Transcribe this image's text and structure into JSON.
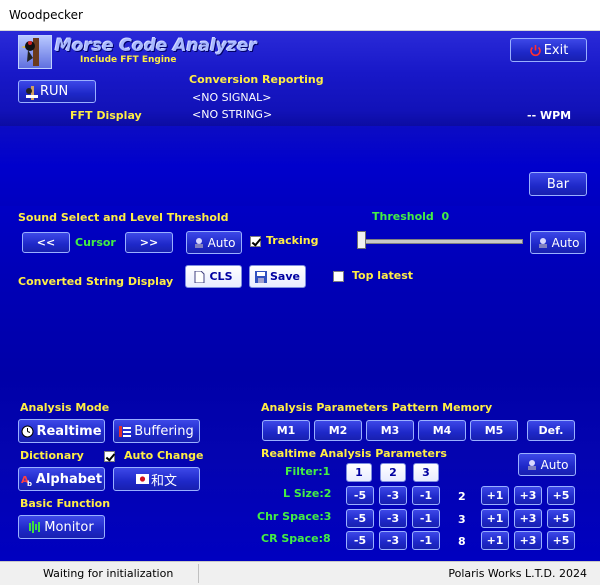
{
  "window": {
    "title": "Woodpecker"
  },
  "header": {
    "app_name": "Morse Code Analyzer",
    "subtitle": "Include FFT Engine",
    "exit_label": "Exit"
  },
  "run": {
    "label": "RUN"
  },
  "conversion": {
    "title": "Conversion Reporting",
    "signal": "<NO SIGNAL>",
    "string": "<NO STRING>",
    "wpm": "-- WPM"
  },
  "fft": {
    "label": "FFT Display",
    "bar_label": "Bar"
  },
  "sound": {
    "title": "Sound Select and Level Threshold",
    "prev": "<<",
    "cursor_label": "Cursor",
    "next": ">>",
    "auto_label": "Auto",
    "tracking_label": "Tracking",
    "tracking_checked": true,
    "threshold_label": "Threshold",
    "threshold_value": "0",
    "threshold_auto_label": "Auto",
    "threshold_level": 0
  },
  "converted": {
    "title": "Converted String Display",
    "cls_label": "CLS",
    "save_label": "Save",
    "top_latest_label": "Top latest",
    "top_latest_checked": false
  },
  "analysis_mode": {
    "title": "Analysis Mode",
    "realtime": "Realtime",
    "buffering": "Buffering"
  },
  "dictionary": {
    "title": "Dictionary",
    "auto_change": "Auto Change",
    "auto_change_checked": true,
    "alphabet": "Alphabet",
    "japanese": "和文"
  },
  "basic": {
    "title": "Basic Function",
    "monitor": "Monitor"
  },
  "memory": {
    "title": "Analysis Parameters Pattern Memory",
    "slots": [
      "M1",
      "M2",
      "M3",
      "M4",
      "M5",
      "Def."
    ]
  },
  "realtime_params": {
    "title": "Realtime Analysis Parameters",
    "auto_label": "Auto",
    "filter_label": "Filter:1",
    "filter_options": [
      "1",
      "2",
      "3"
    ],
    "rows": [
      {
        "label": "L Size:2",
        "value": "2"
      },
      {
        "label": "Chr Space:3",
        "value": "3"
      },
      {
        "label": "CR Space:8",
        "value": "8"
      }
    ],
    "dec_labels": [
      "-5",
      "-3",
      "-1"
    ],
    "inc_labels": [
      "+1",
      "+3",
      "+5"
    ]
  },
  "status": {
    "left": "Waiting for initialization",
    "right": "Polaris Works L.T.D.  2024"
  }
}
